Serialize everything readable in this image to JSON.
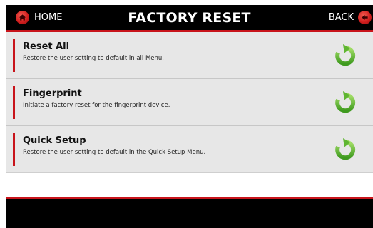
{
  "header": {
    "home_label": "HOME",
    "title": "FACTORY RESET",
    "back_label": "BACK",
    "accent_color": "#c8141b"
  },
  "items": [
    {
      "title": "Reset All",
      "description": "Restore the user setting to default in all Menu.",
      "icon": "reset-arrow-icon"
    },
    {
      "title": "Fingerprint",
      "description": "Initiate a factory reset for the fingerprint device.",
      "icon": "reset-arrow-icon"
    },
    {
      "title": "Quick Setup",
      "description": "Restore the user setting to default in the Quick Setup Menu.",
      "icon": "reset-arrow-icon"
    }
  ],
  "colors": {
    "bar_background": "#000000",
    "row_background": "#e7e7e7",
    "icon_green": "#6cbd3b"
  }
}
